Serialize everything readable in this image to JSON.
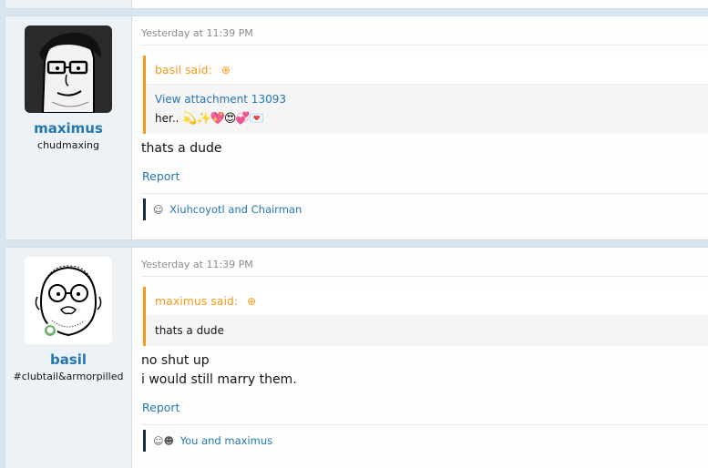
{
  "posts": [
    {
      "date": "Yesterday at 11:39 PM",
      "user": {
        "name": "maximus",
        "title": "chudmaxing"
      },
      "quote": {
        "author_label": "basil said:",
        "link": "View attachment 13093",
        "text": "her..",
        "emojis": "💫✨💖😍💞💌"
      },
      "message_lines": [
        "thats a dude"
      ],
      "report_label": "Report",
      "likes_text": "Xiuhcoyotl and Chairman"
    },
    {
      "date": "Yesterday at 11:39 PM",
      "user": {
        "name": "basil",
        "title": "#clubtail&armorpilled"
      },
      "quote": {
        "author_label": "maximus said:",
        "text": "thats a dude"
      },
      "message_lines": [
        "no shut up",
        "i would still marry them."
      ],
      "report_label": "Report",
      "likes_text": "You and maximus"
    }
  ],
  "icons": {
    "quote_up": "↑-in-circle",
    "online": "person"
  },
  "colors": {
    "accent_link": "#2577b1",
    "quote_accent": "#f49a1b",
    "online": "#6fb36c"
  }
}
